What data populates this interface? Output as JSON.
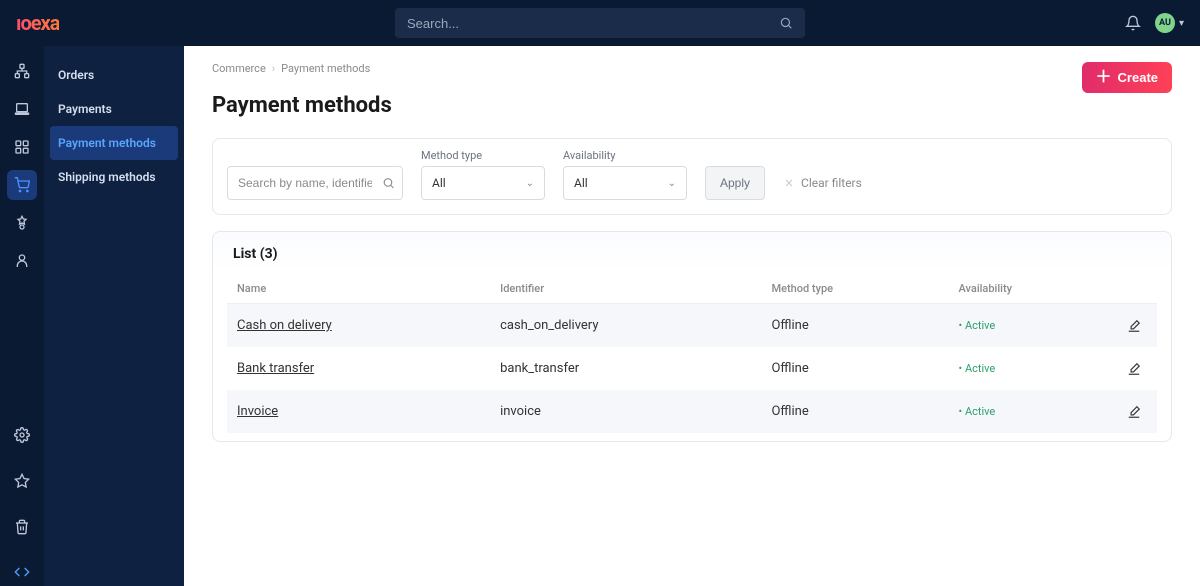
{
  "brand": "ıoexa",
  "search": {
    "placeholder": "Search..."
  },
  "user": {
    "initials": "AU"
  },
  "submenu": {
    "items": [
      {
        "label": "Orders",
        "active": false
      },
      {
        "label": "Payments",
        "active": false
      },
      {
        "label": "Payment methods",
        "active": true
      },
      {
        "label": "Shipping methods",
        "active": false
      }
    ]
  },
  "breadcrumb": {
    "root": "Commerce",
    "current": "Payment methods"
  },
  "page": {
    "title": "Payment methods"
  },
  "buttons": {
    "create": "Create",
    "apply": "Apply",
    "clear_filters": "Clear filters"
  },
  "filters": {
    "search_placeholder": "Search by name, identifier",
    "method_type": {
      "label": "Method type",
      "value": "All"
    },
    "availability": {
      "label": "Availability",
      "value": "All"
    }
  },
  "list": {
    "title": "List (3)",
    "columns": {
      "name": "Name",
      "identifier": "Identifier",
      "method_type": "Method type",
      "availability": "Availability"
    },
    "rows": [
      {
        "name": "Cash on delivery",
        "identifier": "cash_on_delivery",
        "method_type": "Offline",
        "availability": "Active"
      },
      {
        "name": "Bank transfer",
        "identifier": "bank_transfer",
        "method_type": "Offline",
        "availability": "Active"
      },
      {
        "name": "Invoice",
        "identifier": "invoice",
        "method_type": "Offline",
        "availability": "Active"
      }
    ]
  }
}
